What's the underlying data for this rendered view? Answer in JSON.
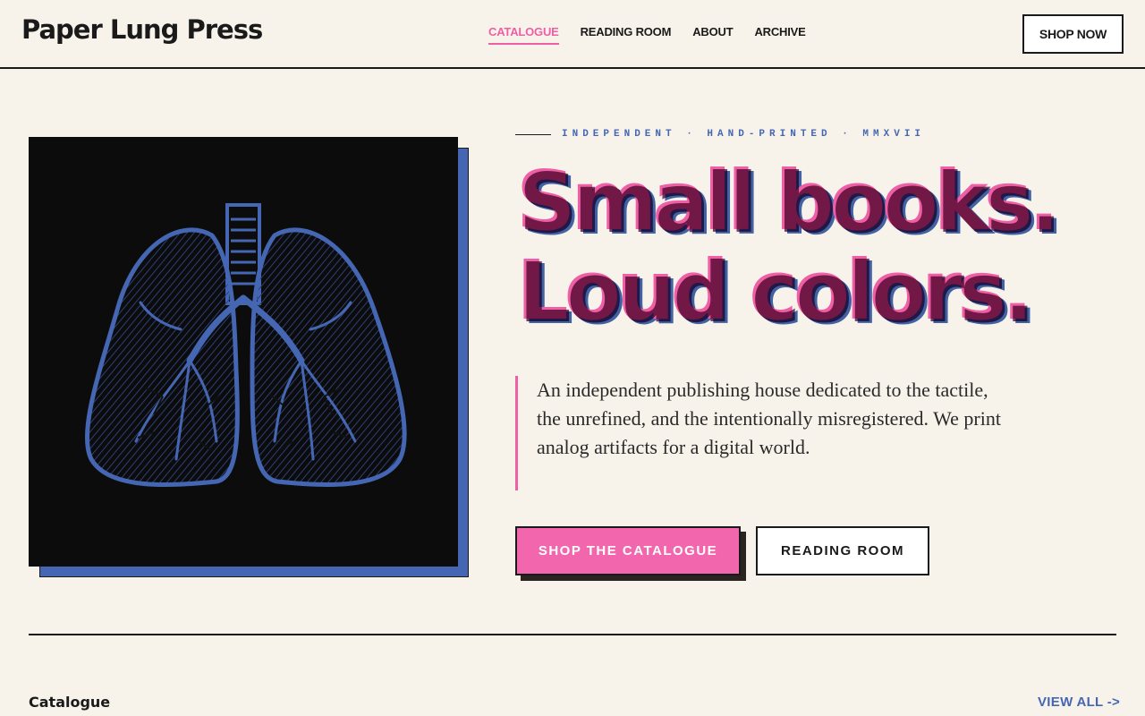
{
  "header": {
    "brand": "Paper Lung Press",
    "nav": [
      {
        "label": "CATALOGUE",
        "active": true
      },
      {
        "label": "READING ROOM",
        "active": false
      },
      {
        "label": "ABOUT",
        "active": false
      },
      {
        "label": "ARCHIVE",
        "active": false
      }
    ],
    "cta": "SHOP NOW"
  },
  "hero": {
    "eyebrow": "INDEPENDENT · HAND-PRINTED · MMXVII",
    "headline_line1": "Small books.",
    "headline_line2": "Loud colors.",
    "lede": "An independent publishing house dedicated to the tactile, the unrefined, and the intentionally misregistered. We print analog artifacts for a digital world.",
    "primary_button": "SHOP THE CATALOGUE",
    "secondary_button": "READING ROOM",
    "image_icon": "lungs-illustration"
  },
  "catalogue": {
    "title": "Catalogue",
    "view_all": "VIEW ALL ->"
  },
  "colors": {
    "background": "#f8f3ea",
    "pink": "#ee5fa5",
    "blue": "#4567b3",
    "ink": "#1a1a1a"
  }
}
